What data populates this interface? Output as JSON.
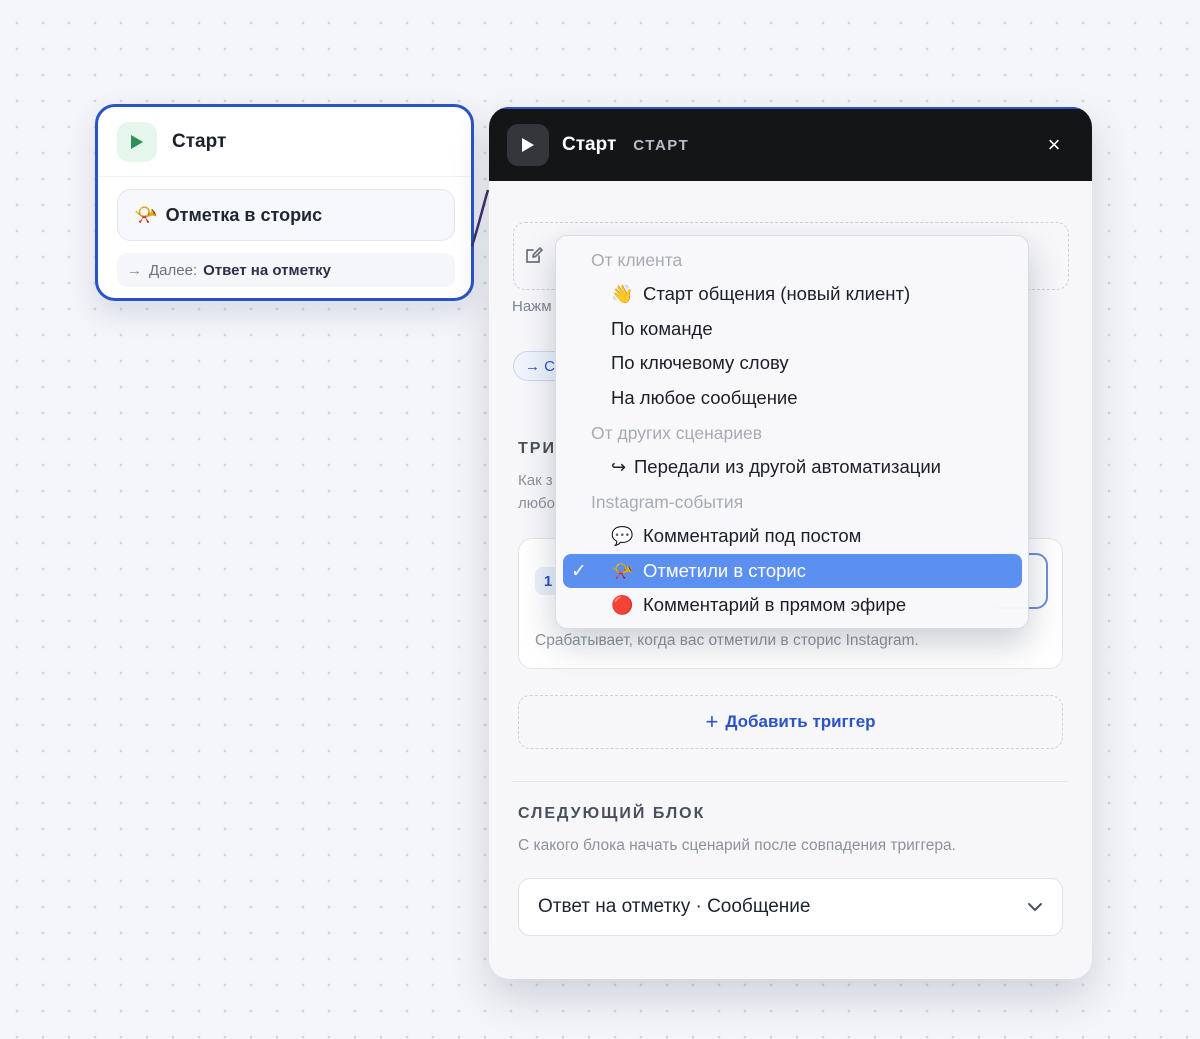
{
  "node": {
    "title": "Старт",
    "trigger": {
      "emoji": "📯",
      "label": "Отметка в сторис"
    },
    "next": {
      "arrow": "→",
      "prefix": "Далее:",
      "target": "Ответ на отметку"
    }
  },
  "panel": {
    "title": "Старт",
    "type_label": "СТАРТ",
    "close_icon": "×",
    "hint_partial": "Нажм",
    "chip_partial": "→ С",
    "triggers_section": {
      "label_partial": "ТРИ",
      "desc_line1_partial": "Как з",
      "desc_line2_partial": "любо"
    },
    "trigger_card": {
      "number": "1",
      "caption": "Срабатывает, когда вас отметили в сторис Instagram."
    },
    "add_trigger": {
      "icon": "+",
      "label": "Добавить триггер"
    },
    "next_block": {
      "label": "СЛЕДУЮЩИЙ БЛОК",
      "description": "С какого блока начать сценарий после совпадения триггера.",
      "selected": "Ответ на отметку · Сообщение"
    }
  },
  "dropdown": {
    "groups": [
      {
        "label": "От клиента",
        "items": [
          {
            "emoji": "👋",
            "label": "Старт общения (новый клиент)"
          },
          {
            "emoji": "",
            "label": "По команде"
          },
          {
            "emoji": "",
            "label": "По ключевому слову"
          },
          {
            "emoji": "",
            "label": "На любое сообщение"
          }
        ]
      },
      {
        "label": "От других сценариев",
        "items": [
          {
            "emoji": "↪",
            "label": "Передали из другой автоматизации"
          }
        ]
      },
      {
        "label": "Instagram-события",
        "items": [
          {
            "emoji": "💬",
            "label": "Комментарий под постом"
          },
          {
            "emoji": "📯",
            "label": "Отметили в сторис",
            "selected": true,
            "check": "✓"
          },
          {
            "emoji": "🔴",
            "label": "Комментарий в прямом эфире"
          }
        ]
      }
    ]
  },
  "colors": {
    "accent": "#2a54c6",
    "selected_item": "#5b8ff0",
    "panel_header": "#141517",
    "start_icon": "#2f8f57"
  },
  "icons": [
    "play-icon",
    "edit-icon",
    "close-icon",
    "chevron-down-icon",
    "check-icon",
    "arrow-right-icon"
  ]
}
